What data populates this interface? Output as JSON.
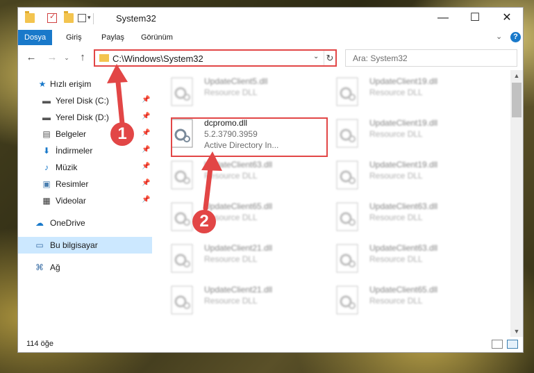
{
  "window": {
    "title": "System32",
    "minimize": "—",
    "maximize": "☐",
    "close": "✕"
  },
  "ribbon": {
    "tabs": [
      {
        "label": "Dosya",
        "active": true
      },
      {
        "label": "Giriş"
      },
      {
        "label": "Paylaş"
      },
      {
        "label": "Görünüm"
      }
    ],
    "expand_icon": "⌄",
    "help_label": "?"
  },
  "address": {
    "path": "C:\\Windows\\System32",
    "search_placeholder": "Ara: System32",
    "refresh_icon": "↻",
    "dropdown_icon": "⌄"
  },
  "nav": {
    "back": "←",
    "forward": "→",
    "history": "⌄",
    "up": "↑"
  },
  "sidebar": {
    "quick_access": "Hızlı erişim",
    "items": [
      {
        "label": "Yerel Disk (C:)",
        "icon": "drive-icon",
        "pinned": true
      },
      {
        "label": "Yerel Disk (D:)",
        "icon": "drive-icon",
        "pinned": true
      },
      {
        "label": "Belgeler",
        "icon": "documents-icon",
        "pinned": true
      },
      {
        "label": "İndirmeler",
        "icon": "downloads-icon",
        "pinned": true
      },
      {
        "label": "Müzik",
        "icon": "music-icon",
        "pinned": true
      },
      {
        "label": "Resimler",
        "icon": "pictures-icon",
        "pinned": true
      },
      {
        "label": "Videolar",
        "icon": "videos-icon",
        "pinned": true
      }
    ],
    "onedrive": "OneDrive",
    "this_pc": "Bu bilgisayar",
    "network": "Ağ"
  },
  "files": {
    "highlighted": {
      "name": "dcpromo.dll",
      "version": "5.2.3790.3959",
      "description": "Active Directory In..."
    },
    "left_column": [
      {
        "name": "UpdateClient5.dll",
        "type": "Resource DLL"
      },
      {
        "name": "UpdateClient63.dll",
        "type": "Resource DLL"
      },
      {
        "name": "UpdateClient65.dll",
        "type": "Resource DLL"
      },
      {
        "name": "UpdateClient21.dll",
        "type": "Resource DLL"
      },
      {
        "name": "UpdateClient21.dll",
        "type": "Resource DLL"
      }
    ],
    "right_column": [
      {
        "name": "UpdateClient19.dll",
        "type": "Resource DLL"
      },
      {
        "name": "UpdateClient19.dll",
        "type": "Resource DLL"
      },
      {
        "name": "UpdateClient19.dll",
        "type": "Resource DLL"
      },
      {
        "name": "UpdateClient63.dll",
        "type": "Resource DLL"
      },
      {
        "name": "UpdateClient63.dll",
        "type": "Resource DLL"
      },
      {
        "name": "UpdateClient65.dll",
        "type": "Resource DLL"
      }
    ]
  },
  "status": {
    "item_count": "114 öğe"
  },
  "annotations": {
    "step1": "1",
    "step2": "2",
    "color": "#e24646"
  },
  "colors": {
    "accent": "#1979ca",
    "selection": "#cce8ff",
    "annotation": "#e24646"
  }
}
